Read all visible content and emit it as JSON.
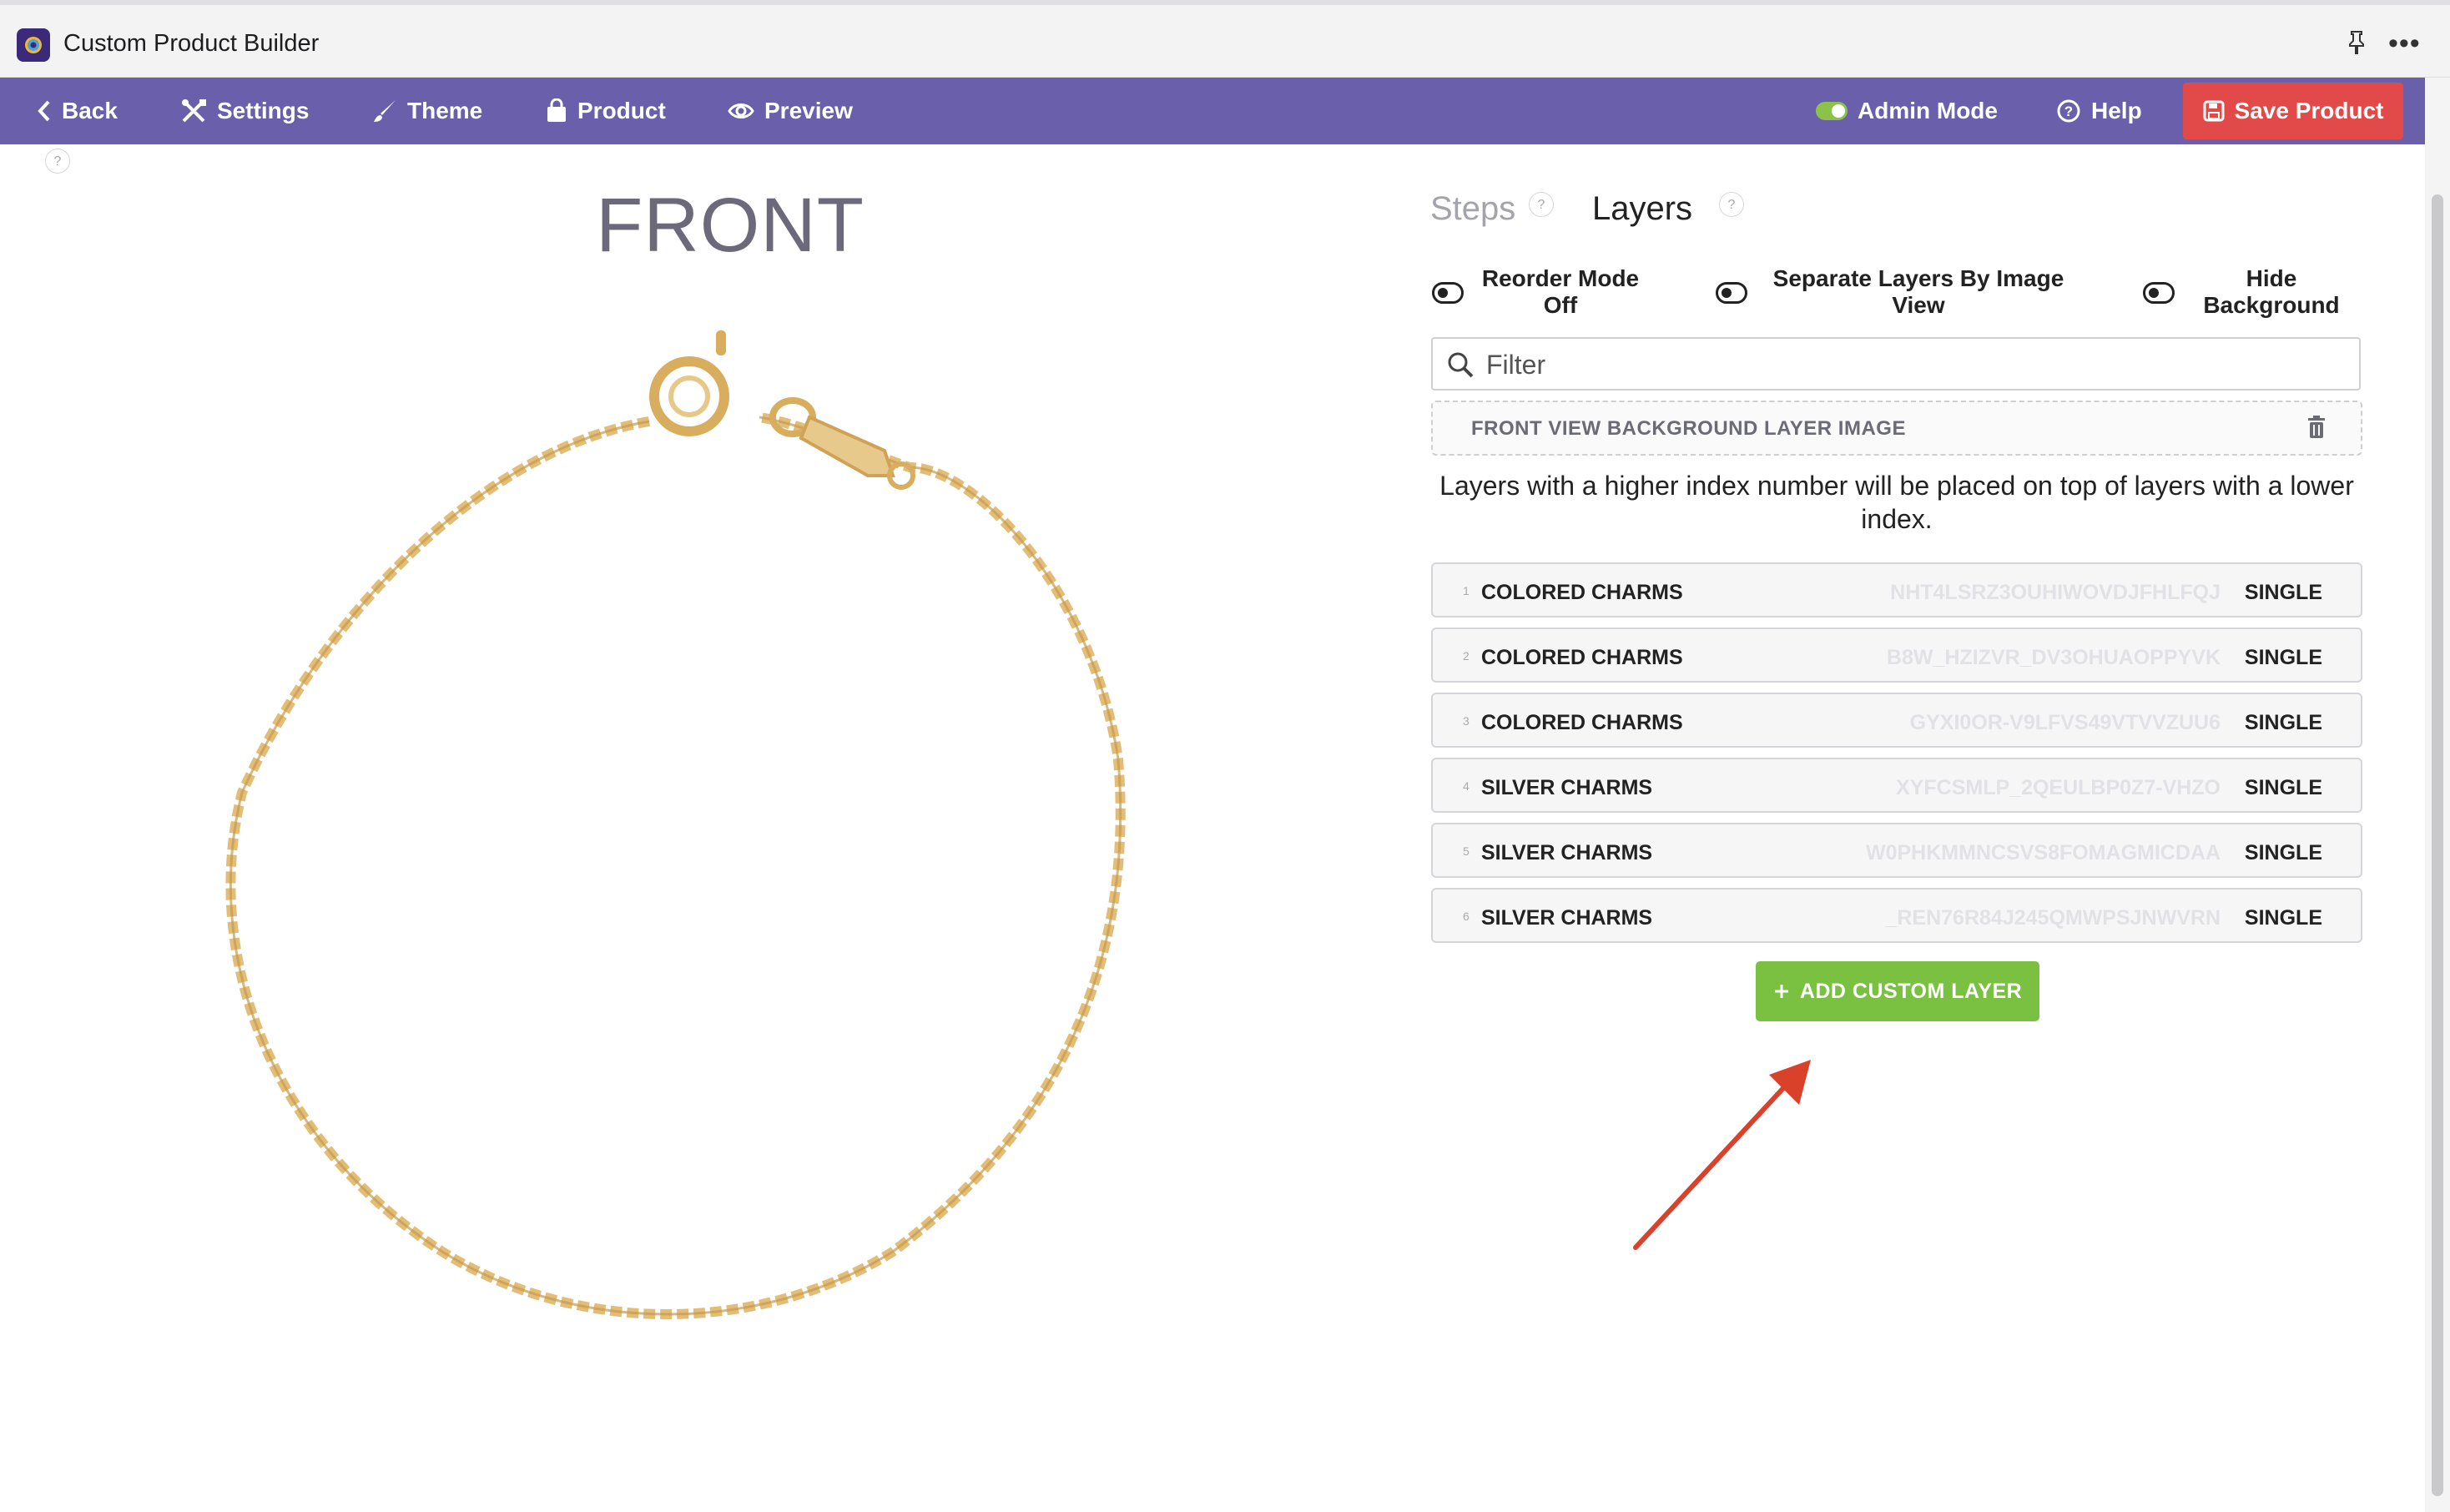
{
  "app": {
    "title": "Custom Product Builder"
  },
  "toolbar": {
    "back": "Back",
    "settings": "Settings",
    "theme": "Theme",
    "product": "Product",
    "preview": "Preview",
    "admin_mode": "Admin Mode",
    "admin_mode_on": true,
    "help": "Help",
    "save": "Save Product"
  },
  "preview": {
    "view_title": "FRONT"
  },
  "panel": {
    "tabs": [
      {
        "label": "Steps",
        "active": false
      },
      {
        "label": "Layers",
        "active": true
      }
    ],
    "help_mark": "?",
    "toggles": [
      {
        "label_line1": "Reorder Mode",
        "label_line2": "Off",
        "on": false
      },
      {
        "label_line1": "Separate Layers By Image",
        "label_line2": "View",
        "on": false
      },
      {
        "label_line1": "Hide",
        "label_line2": "Background",
        "on": false
      }
    ],
    "filter": {
      "placeholder": "Filter",
      "value": ""
    },
    "background_layer": "FRONT VIEW BACKGROUND LAYER IMAGE",
    "note": "Layers with a higher index number will be placed on top of layers with a lower index.",
    "layers": [
      {
        "index": "1",
        "name": "COLORED CHARMS",
        "code": "NHT4LSRZ3OUHIWOVDJFHLFQJ",
        "type": "SINGLE"
      },
      {
        "index": "2",
        "name": "COLORED CHARMS",
        "code": "B8W_HZIZVR_DV3OHUAOPPYVK",
        "type": "SINGLE"
      },
      {
        "index": "3",
        "name": "COLORED CHARMS",
        "code": "GYXI0OR-V9LFVS49VTVVZUU6",
        "type": "SINGLE"
      },
      {
        "index": "4",
        "name": "SILVER CHARMS",
        "code": "XYFCSMLP_2QEULBP0Z7-VHZO",
        "type": "SINGLE"
      },
      {
        "index": "5",
        "name": "SILVER CHARMS",
        "code": "W0PHKMMNCSVS8FOMAGMICDAA",
        "type": "SINGLE"
      },
      {
        "index": "6",
        "name": "SILVER CHARMS",
        "code": "_REN76R84J245QMWPSJNWVRN",
        "type": "SINGLE"
      }
    ],
    "add_layer": "ADD CUSTOM LAYER"
  },
  "colors": {
    "toolbar_bg": "#6a5fab",
    "save_button": "#e24a4a",
    "add_button": "#7ac142",
    "annotation_arrow": "#d9412b"
  },
  "icons": [
    "app-logo",
    "pin-icon",
    "more-icon",
    "chevron-left-icon",
    "tools-icon",
    "brush-icon",
    "bag-icon",
    "eye-icon",
    "toggle-icon",
    "help-circle-icon",
    "floppy-icon",
    "search-icon",
    "trash-icon",
    "plus-icon",
    "arrow-annotation"
  ]
}
